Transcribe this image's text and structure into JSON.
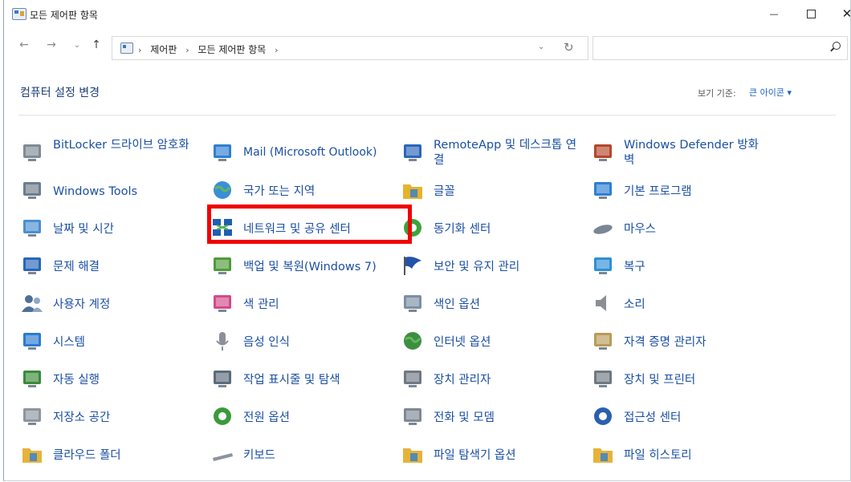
{
  "window": {
    "title": "모든 제어판 항목",
    "minimize": "—",
    "close": "✕"
  },
  "nav": {
    "back": "←",
    "forward": "→",
    "recent": "⌄",
    "up": "↑",
    "breadcrumbs": [
      "제어판",
      "모든 제어판 항목"
    ],
    "separator": "›",
    "dropdown": "⌄",
    "refresh": "↻",
    "search_placeholder": ""
  },
  "header": {
    "title": "컴퓨터 설정 변경",
    "view_by_label": "보기 기준:",
    "view_by_value": "큰 아이콘 ▾"
  },
  "items": [
    {
      "label": "BitLocker 드라이브 암호화",
      "icon": "bitlocker-icon",
      "color": "#7f8a96"
    },
    {
      "label": "Mail (Microsoft Outlook)",
      "icon": "mail-icon",
      "color": "#2f7fd2"
    },
    {
      "label": "RemoteApp 및 데스크톱 연결",
      "icon": "remoteapp-icon",
      "color": "#2966b8"
    },
    {
      "label": "Windows Defender 방화벽",
      "icon": "firewall-icon",
      "color": "#b4472a"
    },
    {
      "label": "Windows Tools",
      "icon": "gears-icon",
      "color": "#6d7d8c"
    },
    {
      "label": "국가 또는 지역",
      "icon": "globe-clock-icon",
      "color": "#3a8fd6"
    },
    {
      "label": "글꼴",
      "icon": "font-icon",
      "color": "#e5b32c"
    },
    {
      "label": "기본 프로그램",
      "icon": "default-programs-icon",
      "color": "#2f7fd2"
    },
    {
      "label": "날짜 및 시간",
      "icon": "calendar-clock-icon",
      "color": "#4a8fd0"
    },
    {
      "label": "네트워크 및 공유 센터",
      "icon": "network-icon",
      "color": "#1e5fb4"
    },
    {
      "label": "동기화 센터",
      "icon": "sync-icon",
      "color": "#3da33a"
    },
    {
      "label": "마우스",
      "icon": "mouse-icon",
      "color": "#7a8694"
    },
    {
      "label": "문제 해결",
      "icon": "troubleshoot-icon",
      "color": "#2966b8"
    },
    {
      "label": "백업 및 복원(Windows 7)",
      "icon": "backup-icon",
      "color": "#4f9a3a"
    },
    {
      "label": "보안 및 유지 관리",
      "icon": "flag-icon",
      "color": "#2352a8"
    },
    {
      "label": "복구",
      "icon": "recovery-icon",
      "color": "#2f8fd6"
    },
    {
      "label": "사용자 계정",
      "icon": "users-icon",
      "color": "#4d6f96"
    },
    {
      "label": "색 관리",
      "icon": "color-management-icon",
      "color": "#d24a8b"
    },
    {
      "label": "색인 옵션",
      "icon": "indexing-icon",
      "color": "#7d8fa3"
    },
    {
      "label": "소리",
      "icon": "speaker-icon",
      "color": "#8a8f96"
    },
    {
      "label": "시스템",
      "icon": "system-icon",
      "color": "#2c7ad0"
    },
    {
      "label": "음성 인식",
      "icon": "microphone-icon",
      "color": "#8b9099"
    },
    {
      "label": "인터넷 옵션",
      "icon": "internet-options-icon",
      "color": "#3e8e41"
    },
    {
      "label": "자격 증명 관리자",
      "icon": "credential-icon",
      "color": "#b89b58"
    },
    {
      "label": "자동 실행",
      "icon": "autoplay-icon",
      "color": "#3a8a3a"
    },
    {
      "label": "작업 표시줄 및 탐색",
      "icon": "taskbar-icon",
      "color": "#5b6b7b"
    },
    {
      "label": "장치 관리자",
      "icon": "device-manager-icon",
      "color": "#6f7882"
    },
    {
      "label": "장치 및 프린터",
      "icon": "printer-icon",
      "color": "#6f7882"
    },
    {
      "label": "저장소 공간",
      "icon": "storage-icon",
      "color": "#8d959e"
    },
    {
      "label": "전원 옵션",
      "icon": "power-icon",
      "color": "#3a9a3a"
    },
    {
      "label": "전화 및 모뎀",
      "icon": "phone-modem-icon",
      "color": "#7f8893"
    },
    {
      "label": "접근성 센터",
      "icon": "accessibility-icon",
      "color": "#2a5fb0"
    },
    {
      "label": "클라우드 폴더",
      "icon": "cloud-folder-icon",
      "color": "#e6b33a"
    },
    {
      "label": "키보드",
      "icon": "keyboard-icon",
      "color": "#8d949c"
    },
    {
      "label": "파일 탐색기 옵션",
      "icon": "folder-options-icon",
      "color": "#e6b33a"
    },
    {
      "label": "파일 히스토리",
      "icon": "file-history-icon",
      "color": "#e6b33a"
    }
  ],
  "accent": "#1b4fa3",
  "highlight_color": "#f00000"
}
